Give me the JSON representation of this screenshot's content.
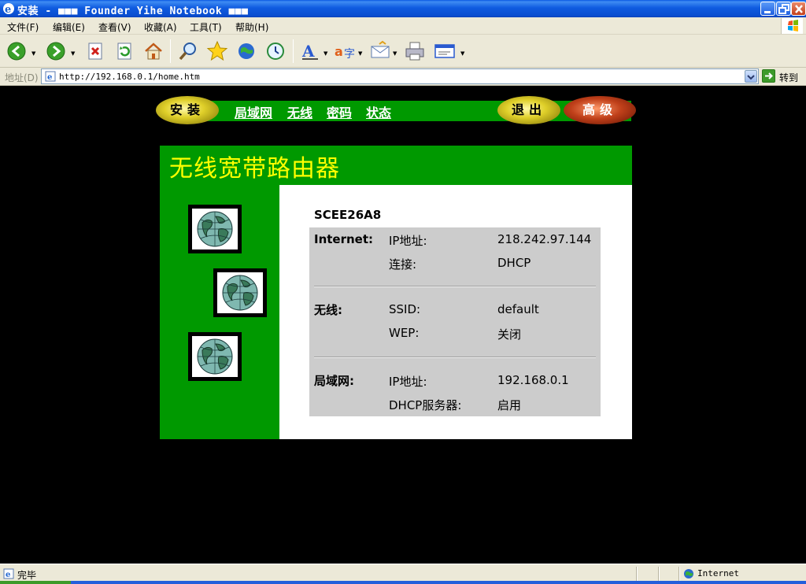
{
  "window": {
    "title": "安装 - ■■■ Founder Yihe Notebook ■■■"
  },
  "menu": [
    "文件(F)",
    "编辑(E)",
    "查看(V)",
    "收藏(A)",
    "工具(T)",
    "帮助(H)"
  ],
  "toolbar": {
    "icons": [
      "back-icon",
      "forward-icon",
      "stop-icon",
      "refresh-icon",
      "home-icon",
      "search-icon",
      "favorites-icon",
      "media-icon",
      "history-icon",
      "font-icon",
      "translate-icon",
      "mail-icon",
      "print-icon",
      "edit-icon"
    ]
  },
  "address": {
    "label": "地址(D)",
    "url": "http://192.168.0.1/home.htm",
    "go_label": "转到"
  },
  "nav": {
    "setup": "安装",
    "links": [
      "局域网",
      "无线",
      "密码",
      "状态"
    ],
    "logout": "退出",
    "advanced": "高级"
  },
  "panel": {
    "title": "无线宽带路由器",
    "device_name": "SCEE26A8",
    "sections": [
      {
        "label": "Internet:",
        "rows": [
          {
            "key": "IP地址:",
            "value": "218.242.97.144"
          },
          {
            "key": "连接:",
            "value": "DHCP"
          }
        ]
      },
      {
        "label": "无线:",
        "rows": [
          {
            "key": "SSID:",
            "value": "default"
          },
          {
            "key": "WEP:",
            "value": "关闭"
          }
        ]
      },
      {
        "label": "局域网:",
        "rows": [
          {
            "key": "IP地址:",
            "value": "192.168.0.1"
          },
          {
            "key": "DHCP服务器:",
            "value": "启用"
          }
        ]
      }
    ]
  },
  "status": {
    "text": "完毕",
    "zone": "Internet"
  },
  "colors": {
    "router_green": "#009900",
    "title_yellow": "#ffff00",
    "table_grey": "#cccccc"
  }
}
